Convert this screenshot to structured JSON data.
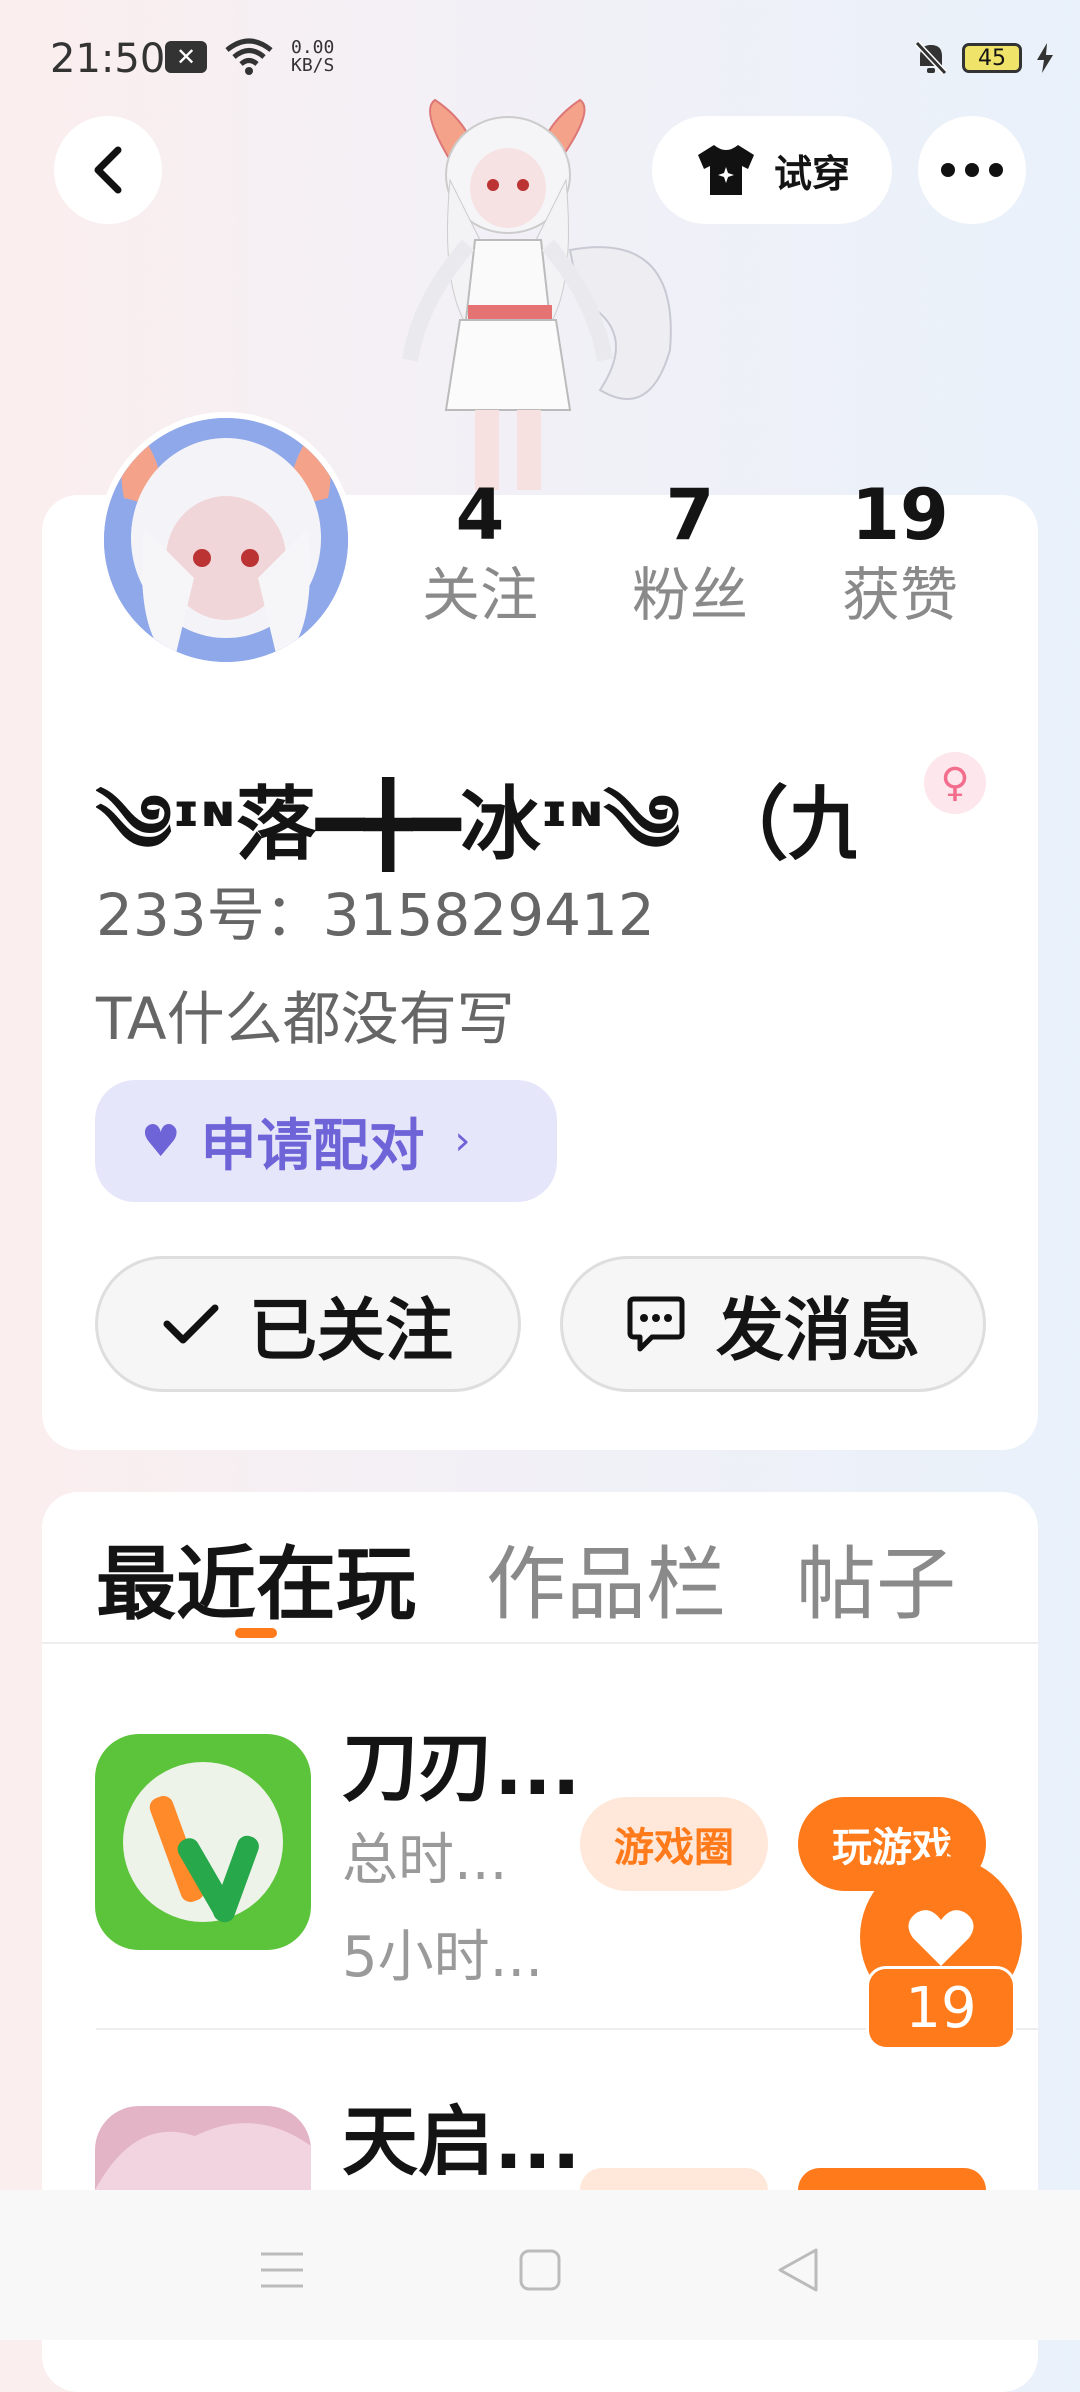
{
  "status_bar": {
    "time": "21:50",
    "speed_value": "0.00",
    "speed_unit": "KB/S",
    "battery": "45"
  },
  "header": {
    "try_on_label": "试穿"
  },
  "profile": {
    "stats": [
      {
        "value": "4",
        "label": "关注"
      },
      {
        "value": "7",
        "label": "粉丝"
      },
      {
        "value": "19",
        "label": "获赞"
      }
    ],
    "nickname": "༄ᶦᶰ落━╋━冰ᶦᶰ༄ （九...",
    "gender_symbol": "♀",
    "uid": "233号：315829412",
    "bio": "TA什么都没有写",
    "match_label": "申请配对",
    "follow_label": "已关注",
    "message_label": "发消息"
  },
  "tabs": [
    {
      "label": "最近在玩"
    },
    {
      "label": "作品栏"
    },
    {
      "label": "帖子"
    }
  ],
  "games": [
    {
      "title": "刀刃...",
      "total_label": "总时...",
      "duration": "5小时...",
      "circle_label": "游戏圈",
      "play_label": "玩游戏"
    },
    {
      "title": "天启..."
    }
  ],
  "likes": {
    "count": "19"
  },
  "colors": {
    "accent": "#ff7a1a",
    "match_purple": "#6f63d8"
  }
}
